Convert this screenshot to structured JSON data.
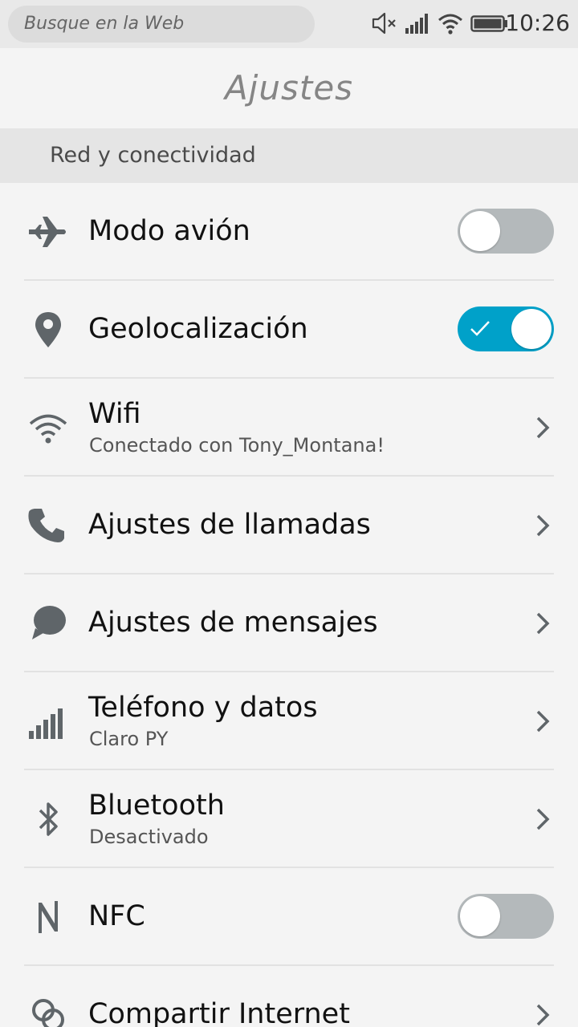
{
  "status_bar": {
    "search_placeholder": "Busque en la Web",
    "time": "10:26",
    "icons": [
      "muted-speaker-icon",
      "cell-signal-icon",
      "wifi-icon",
      "battery-icon"
    ]
  },
  "header": {
    "title": "Ajustes"
  },
  "section": {
    "title": "Red y conectividad"
  },
  "rows": [
    {
      "icon": "airplane-icon",
      "title": "Modo avión",
      "control": "toggle",
      "on": false
    },
    {
      "icon": "location-pin-icon",
      "title": "Geolocalización",
      "control": "toggle",
      "on": true
    },
    {
      "icon": "wifi-icon",
      "title": "Wifi",
      "subtitle": "Conectado con Tony_Montana!",
      "control": "chevron"
    },
    {
      "icon": "phone-icon",
      "title": "Ajustes de llamadas",
      "control": "chevron"
    },
    {
      "icon": "message-bubble-icon",
      "title": "Ajustes de mensajes",
      "control": "chevron"
    },
    {
      "icon": "signal-bars-icon",
      "title": "Teléfono y datos",
      "subtitle": "Claro PY",
      "control": "chevron"
    },
    {
      "icon": "bluetooth-icon",
      "title": "Bluetooth",
      "subtitle": "Desactivado",
      "control": "chevron"
    },
    {
      "icon": "nfc-icon",
      "title": "NFC",
      "control": "toggle",
      "on": false
    },
    {
      "icon": "hotspot-icon",
      "title": "Compartir Internet",
      "control": "chevron"
    }
  ],
  "colors": {
    "accent": "#00a1c9",
    "toggle_off": "#b4b9bb",
    "icon": "#5f6569"
  }
}
